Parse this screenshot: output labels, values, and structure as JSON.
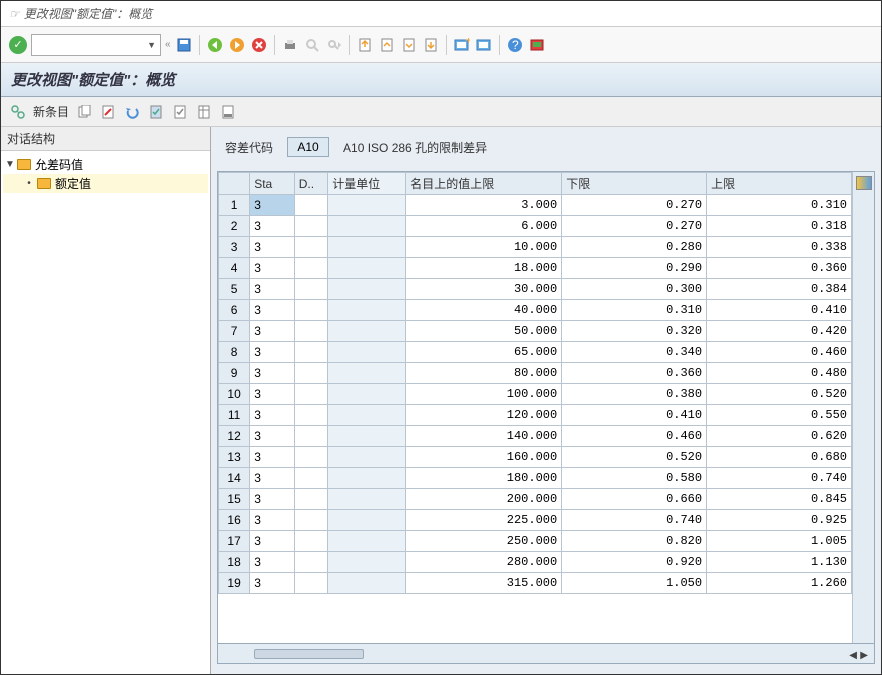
{
  "window": {
    "title": "更改视图\"额定值\"：概览"
  },
  "header2": "更改视图\"额定值\"：概览",
  "subtoolbar": {
    "new_entry": "新条目"
  },
  "leftpane": {
    "title": "对话结构",
    "items": [
      {
        "label": "允差码值",
        "selected": false
      },
      {
        "label": "额定值",
        "selected": true
      }
    ]
  },
  "field": {
    "label": "容差代码",
    "value": "A10",
    "desc": "A10 ISO 286 孔的限制差异"
  },
  "table": {
    "headers": {
      "sta": "Sta",
      "d": "D..",
      "unit": "计量单位",
      "upper_named": "名目上的值上限",
      "lower": "下限",
      "upper": "上限"
    },
    "rows": [
      {
        "n": "1",
        "sta": "3",
        "d": "",
        "unit": "",
        "u1": "3.000",
        "lo": "0.270",
        "hi": "0.310"
      },
      {
        "n": "2",
        "sta": "3",
        "d": "",
        "unit": "",
        "u1": "6.000",
        "lo": "0.270",
        "hi": "0.318"
      },
      {
        "n": "3",
        "sta": "3",
        "d": "",
        "unit": "",
        "u1": "10.000",
        "lo": "0.280",
        "hi": "0.338"
      },
      {
        "n": "4",
        "sta": "3",
        "d": "",
        "unit": "",
        "u1": "18.000",
        "lo": "0.290",
        "hi": "0.360"
      },
      {
        "n": "5",
        "sta": "3",
        "d": "",
        "unit": "",
        "u1": "30.000",
        "lo": "0.300",
        "hi": "0.384"
      },
      {
        "n": "6",
        "sta": "3",
        "d": "",
        "unit": "",
        "u1": "40.000",
        "lo": "0.310",
        "hi": "0.410"
      },
      {
        "n": "7",
        "sta": "3",
        "d": "",
        "unit": "",
        "u1": "50.000",
        "lo": "0.320",
        "hi": "0.420"
      },
      {
        "n": "8",
        "sta": "3",
        "d": "",
        "unit": "",
        "u1": "65.000",
        "lo": "0.340",
        "hi": "0.460"
      },
      {
        "n": "9",
        "sta": "3",
        "d": "",
        "unit": "",
        "u1": "80.000",
        "lo": "0.360",
        "hi": "0.480"
      },
      {
        "n": "10",
        "sta": "3",
        "d": "",
        "unit": "",
        "u1": "100.000",
        "lo": "0.380",
        "hi": "0.520"
      },
      {
        "n": "11",
        "sta": "3",
        "d": "",
        "unit": "",
        "u1": "120.000",
        "lo": "0.410",
        "hi": "0.550"
      },
      {
        "n": "12",
        "sta": "3",
        "d": "",
        "unit": "",
        "u1": "140.000",
        "lo": "0.460",
        "hi": "0.620"
      },
      {
        "n": "13",
        "sta": "3",
        "d": "",
        "unit": "",
        "u1": "160.000",
        "lo": "0.520",
        "hi": "0.680"
      },
      {
        "n": "14",
        "sta": "3",
        "d": "",
        "unit": "",
        "u1": "180.000",
        "lo": "0.580",
        "hi": "0.740"
      },
      {
        "n": "15",
        "sta": "3",
        "d": "",
        "unit": "",
        "u1": "200.000",
        "lo": "0.660",
        "hi": "0.845"
      },
      {
        "n": "16",
        "sta": "3",
        "d": "",
        "unit": "",
        "u1": "225.000",
        "lo": "0.740",
        "hi": "0.925"
      },
      {
        "n": "17",
        "sta": "3",
        "d": "",
        "unit": "",
        "u1": "250.000",
        "lo": "0.820",
        "hi": "1.005"
      },
      {
        "n": "18",
        "sta": "3",
        "d": "",
        "unit": "",
        "u1": "280.000",
        "lo": "0.920",
        "hi": "1.130"
      },
      {
        "n": "19",
        "sta": "3",
        "d": "",
        "unit": "",
        "u1": "315.000",
        "lo": "1.050",
        "hi": "1.260"
      }
    ]
  }
}
